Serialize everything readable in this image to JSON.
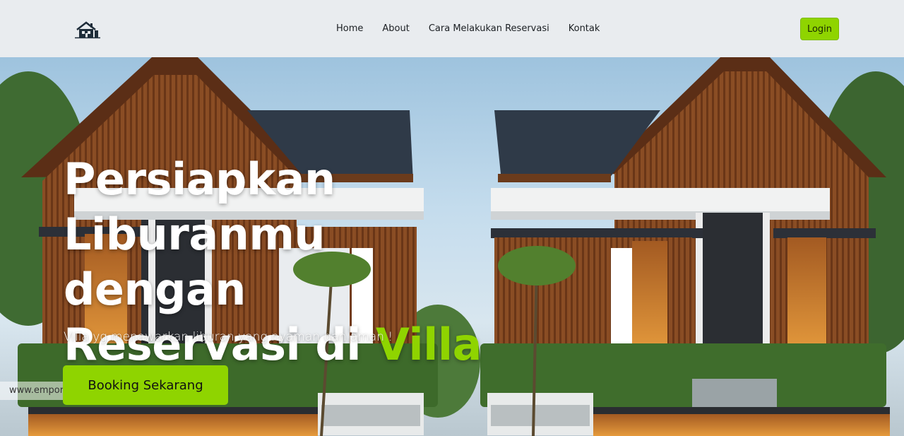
{
  "navbar": {
    "logo_icon": "house-icon",
    "links": [
      "Home",
      "About",
      "Cara Melakukan Reservasi",
      "Kontak"
    ],
    "login_label": "Login",
    "accent_color": "#8fd400"
  },
  "hero": {
    "title_line1": "Persiapkan",
    "title_line2": "Liburanmu dengan",
    "title_line3_prefix": "Reservasi di ",
    "title_line3_accent": "Villa",
    "subtitle": "Villa yg menawarkan liburan yang nyaman dan aman !",
    "cta_label": "Booking Sekarang",
    "watermark": "www.empor"
  }
}
